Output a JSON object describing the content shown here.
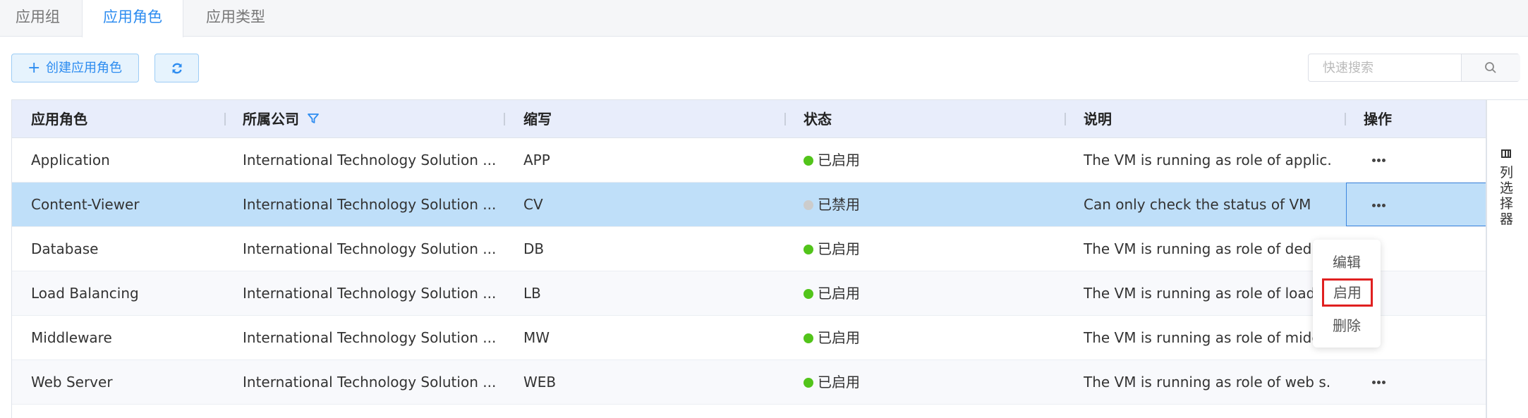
{
  "tabs": [
    {
      "label": "应用组"
    },
    {
      "label": "应用角色",
      "active": true
    },
    {
      "label": "应用类型"
    }
  ],
  "toolbar": {
    "create_label": "创建应用角色",
    "refresh_icon": "refresh-icon"
  },
  "search": {
    "placeholder": "快速搜索",
    "value": ""
  },
  "table": {
    "columns": [
      "应用角色",
      "所属公司",
      "缩写",
      "状态",
      "说明",
      "操作"
    ],
    "rows": [
      {
        "role": "Application",
        "company": "International Technology Solution ...",
        "abbr": "APP",
        "status": "已启用",
        "desc": "The VM is running as role of applic..."
      },
      {
        "role": "Content-Viewer",
        "company": "International Technology Solution ...",
        "abbr": "CV",
        "status": "已禁用",
        "desc": "Can only check the status of VM"
      },
      {
        "role": "Database",
        "company": "International Technology Solution ...",
        "abbr": "DB",
        "status": "已启用",
        "desc": "The VM is running as role of dedica"
      },
      {
        "role": "Load Balancing",
        "company": "International Technology Solution ...",
        "abbr": "LB",
        "status": "已启用",
        "desc": "The VM is running as role of load b"
      },
      {
        "role": "Middleware",
        "company": "International Technology Solution ...",
        "abbr": "MW",
        "status": "已启用",
        "desc": "The VM is running as role of middl..."
      },
      {
        "role": "Web Server",
        "company": "International Technology Solution ...",
        "abbr": "WEB",
        "status": "已启用",
        "desc": "The VM is running as role of web s..."
      }
    ]
  },
  "column_selector_label": "列选择器",
  "action_menu": {
    "items": [
      "编辑",
      "启用",
      "删除"
    ]
  },
  "colors": {
    "accent": "#2d8cf0",
    "enabled": "#52c41a",
    "disabled": "#cccccc",
    "selected_row": "#bfdff9",
    "highlight_border": "#e02020"
  }
}
